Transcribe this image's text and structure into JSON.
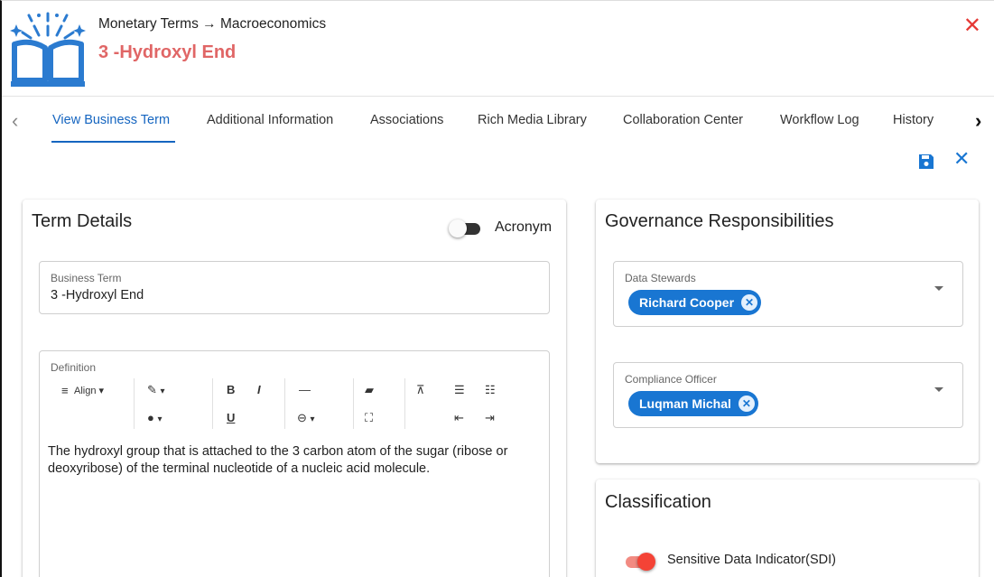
{
  "header": {
    "breadcrumb": "Monetary Terms → Macroeconomics",
    "title": "3 -Hydroxyl End",
    "close_icon": "close-icon"
  },
  "tabs": [
    {
      "label": "View Business Term",
      "active": true
    },
    {
      "label": "Additional Information",
      "active": false
    },
    {
      "label": "Associations",
      "active": false
    },
    {
      "label": "Rich Media Library",
      "active": false
    },
    {
      "label": "Collaboration Center",
      "active": false
    },
    {
      "label": "Workflow Log",
      "active": false
    },
    {
      "label": "History",
      "active": false
    }
  ],
  "actions": {
    "save_icon": "save-icon",
    "cancel_icon": "close-icon"
  },
  "term_details": {
    "title": "Term Details",
    "acronym_label": "Acronym",
    "acronym_on": false,
    "business_term": {
      "label": "Business Term",
      "value": "3 -Hydroxyl End"
    },
    "definition": {
      "label": "Definition",
      "toolbar": {
        "align": "Align ▾",
        "bold": "B",
        "italic": "I",
        "underline": "U",
        "hr": "—",
        "dropdown_caret": "▾"
      },
      "text": "The hydroxyl group that is attached to the 3 carbon atom of the sugar (ribose or deoxyribose) of the terminal nucleotide of a nucleic acid molecule."
    }
  },
  "governance": {
    "title": "Governance Responsibilities",
    "data_stewards": {
      "label": "Data Stewards",
      "chips": [
        "Richard Cooper"
      ]
    },
    "compliance_officer": {
      "label": "Compliance Officer",
      "chips": [
        "Luqman Michal"
      ]
    }
  },
  "classification": {
    "title": "Classification",
    "sdi_label": "Sensitive Data Indicator(SDI)",
    "sdi_on": true
  },
  "colors": {
    "accent": "#1976d2",
    "title_red": "#e06666",
    "close_red": "#e53935",
    "toggle_on": "#f44336"
  }
}
